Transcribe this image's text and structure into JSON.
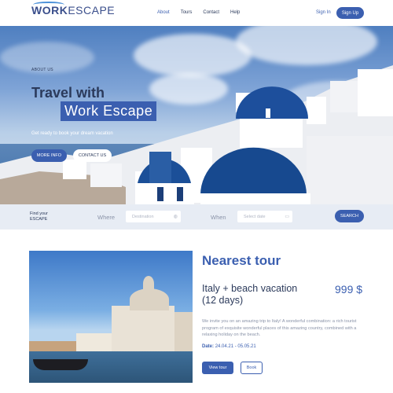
{
  "brand": {
    "logo_bold": "WORK",
    "logo_rest": "ESCAPE"
  },
  "nav": {
    "items": [
      "About",
      "Tours",
      "Contact",
      "Help"
    ],
    "active": "About",
    "signin": "Sign In",
    "signup": "Sign Up"
  },
  "hero": {
    "eyebrow": "ABOUT US",
    "title_line1": "Travel with",
    "title_line2": "Work Escape",
    "subtitle": "Get ready to book your dream vacation",
    "btn_more": "MORE INFO",
    "btn_contact": "CONTACT US"
  },
  "search": {
    "find_line1": "Find your",
    "find_line2": "ESCAPE",
    "where_label": "Where",
    "where_placeholder": "Destination",
    "when_label": "When",
    "when_placeholder": "Select date",
    "button": "SEARCH"
  },
  "tour": {
    "section_title": "Nearest tour",
    "title_line1": "Italy + beach vacation",
    "title_line2": "(12 days)",
    "price": "999 $",
    "description": "We invite you on an amazing trip to Italy! A wonderful combination: a rich tourist program of exquisite wonderful places of this amazing country, combined with a relaxing holiday on the beach.",
    "date_label": "Date:",
    "date_value": "24.04.21 - 05.05.21",
    "view_button": "View tour",
    "book_button": "Book"
  },
  "colors": {
    "accent": "#3b5fb0",
    "text": "#2b3a5b",
    "muted": "#8a93a8",
    "search_bg": "#e7ecf4"
  }
}
